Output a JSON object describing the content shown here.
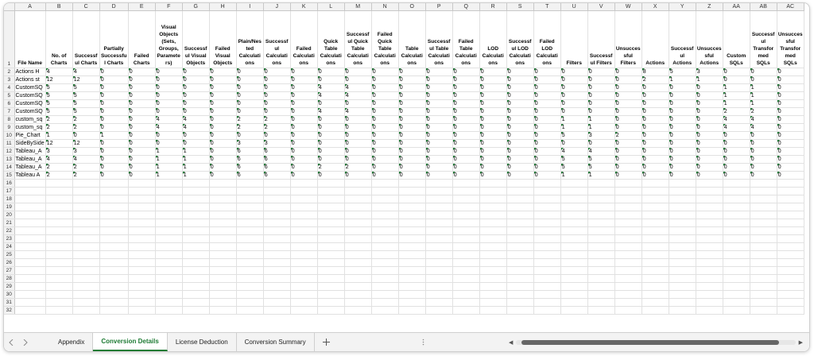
{
  "columns": [
    "A",
    "B",
    "C",
    "D",
    "E",
    "F",
    "G",
    "H",
    "I",
    "J",
    "K",
    "L",
    "M",
    "N",
    "O",
    "P",
    "Q",
    "R",
    "S",
    "T",
    "U",
    "V",
    "W",
    "X",
    "Y",
    "Z",
    "AA",
    "AB",
    "AC"
  ],
  "headers": [
    "File Name",
    "No. of Charts",
    "Successful Charts",
    "Partially Successful Charts",
    "Failed Charts",
    "Visual Objects (Sets, Groups, Parameters)",
    "Successful Visual Objects",
    "Failed Visual Objects",
    "Plain/Nested Calculations",
    "Successful Calculations",
    "Failed Calculations",
    "Quick Table Calculations",
    "Successful Quick Table Calculations",
    "Failed Quick Table Calculations",
    "Table Calculations",
    "Successful Table Calculations",
    "Failed Table Calculations",
    "LOD Calculations",
    "Successful LOD Calculations",
    "Failed LOD Calculations",
    "Filters",
    "Successful Filters",
    "Unsuccessful Filters",
    "Actions",
    "Successful Actions",
    "Unsuccessful Actions",
    "Custom SQLs",
    "Successful Transformed SQLs",
    "Unsuccessful Transformed SQLs"
  ],
  "rows": [
    {
      "name": "Actions H",
      "values": [
        4,
        4,
        0,
        0,
        0,
        0,
        0,
        0,
        0,
        0,
        0,
        0,
        0,
        0,
        0,
        0,
        0,
        0,
        0,
        0,
        0,
        0,
        8,
        5,
        3,
        0,
        0,
        0
      ]
    },
    {
      "name": "Actions st",
      "values": [
        12,
        12,
        0,
        0,
        0,
        0,
        0,
        0,
        0,
        0,
        0,
        0,
        0,
        0,
        0,
        0,
        0,
        0,
        0,
        0,
        0,
        0,
        2,
        1,
        1,
        0,
        0,
        0
      ]
    },
    {
      "name": "CustomSQ",
      "values": [
        5,
        5,
        0,
        0,
        0,
        0,
        0,
        0,
        0,
        0,
        4,
        4,
        0,
        0,
        0,
        0,
        0,
        0,
        0,
        0,
        0,
        0,
        0,
        0,
        0,
        1,
        1,
        0
      ]
    },
    {
      "name": "CustomSQ",
      "values": [
        5,
        5,
        0,
        0,
        0,
        0,
        0,
        0,
        0,
        0,
        4,
        4,
        0,
        0,
        0,
        0,
        0,
        0,
        0,
        0,
        0,
        0,
        0,
        0,
        0,
        1,
        1,
        0
      ]
    },
    {
      "name": "CustomSQ",
      "values": [
        5,
        5,
        0,
        0,
        0,
        0,
        0,
        0,
        0,
        0,
        0,
        0,
        0,
        0,
        0,
        0,
        0,
        0,
        0,
        0,
        0,
        0,
        0,
        0,
        0,
        1,
        1,
        0
      ]
    },
    {
      "name": "CustomSQ",
      "values": [
        5,
        5,
        0,
        0,
        0,
        0,
        0,
        0,
        0,
        0,
        4,
        4,
        0,
        0,
        0,
        0,
        0,
        0,
        0,
        0,
        0,
        0,
        0,
        0,
        0,
        2,
        2,
        0
      ]
    },
    {
      "name": "custom_sq",
      "values": [
        2,
        2,
        0,
        0,
        4,
        4,
        0,
        2,
        2,
        0,
        0,
        0,
        0,
        0,
        0,
        0,
        0,
        0,
        0,
        1,
        1,
        0,
        0,
        0,
        0,
        4,
        4,
        0
      ]
    },
    {
      "name": "custom_sq",
      "values": [
        2,
        2,
        0,
        0,
        4,
        4,
        0,
        2,
        2,
        0,
        0,
        0,
        0,
        0,
        0,
        0,
        0,
        0,
        0,
        1,
        1,
        0,
        0,
        0,
        0,
        4,
        4,
        0
      ]
    },
    {
      "name": "Pie_Chart",
      "values": [
        1,
        0,
        1,
        0,
        0,
        0,
        0,
        0,
        0,
        0,
        0,
        0,
        0,
        0,
        0,
        0,
        0,
        0,
        0,
        5,
        3,
        2,
        0,
        0,
        0,
        0,
        0,
        0
      ]
    },
    {
      "name": "SideBySide",
      "values": [
        12,
        12,
        0,
        0,
        0,
        0,
        0,
        3,
        3,
        0,
        0,
        0,
        0,
        0,
        0,
        0,
        0,
        0,
        0,
        0,
        0,
        0,
        0,
        0,
        0,
        0,
        0,
        0
      ]
    },
    {
      "name": "Tableau_A",
      "values": [
        3,
        3,
        0,
        0,
        1,
        1,
        0,
        6,
        6,
        0,
        0,
        0,
        0,
        0,
        0,
        0,
        0,
        0,
        0,
        4,
        4,
        0,
        0,
        0,
        0,
        0,
        0,
        0
      ]
    },
    {
      "name": "Tableau_A",
      "values": [
        4,
        4,
        0,
        0,
        1,
        1,
        0,
        6,
        6,
        0,
        0,
        0,
        0,
        0,
        0,
        0,
        0,
        0,
        0,
        5,
        5,
        0,
        0,
        0,
        0,
        0,
        0,
        0
      ]
    },
    {
      "name": "Tableau_A",
      "values": [
        2,
        2,
        0,
        0,
        1,
        1,
        0,
        6,
        6,
        0,
        2,
        2,
        0,
        0,
        0,
        0,
        0,
        0,
        0,
        5,
        5,
        0,
        0,
        0,
        0,
        0,
        0,
        0
      ]
    },
    {
      "name": "Tableau A",
      "values": [
        2,
        2,
        0,
        0,
        1,
        1,
        0,
        6,
        6,
        0,
        0,
        0,
        0,
        0,
        0,
        0,
        0,
        0,
        0,
        1,
        1,
        0,
        0,
        0,
        0,
        0,
        0,
        0
      ]
    }
  ],
  "blank_row_numbers": [
    16,
    17,
    18,
    19,
    20,
    21,
    22,
    23,
    24,
    25,
    26,
    27,
    28,
    29,
    30,
    31,
    32
  ],
  "tabs": [
    {
      "label": "Appendix",
      "active": false
    },
    {
      "label": "Conversion Details",
      "active": true
    },
    {
      "label": "License Deduction",
      "active": false
    },
    {
      "label": "Conversion Summary",
      "active": false
    }
  ],
  "add_sheet_icon": "plus-icon",
  "prev_sheet_icon": "chevron-left-icon",
  "next_sheet_icon": "chevron-right-icon",
  "accent_color": "#1e7b34"
}
